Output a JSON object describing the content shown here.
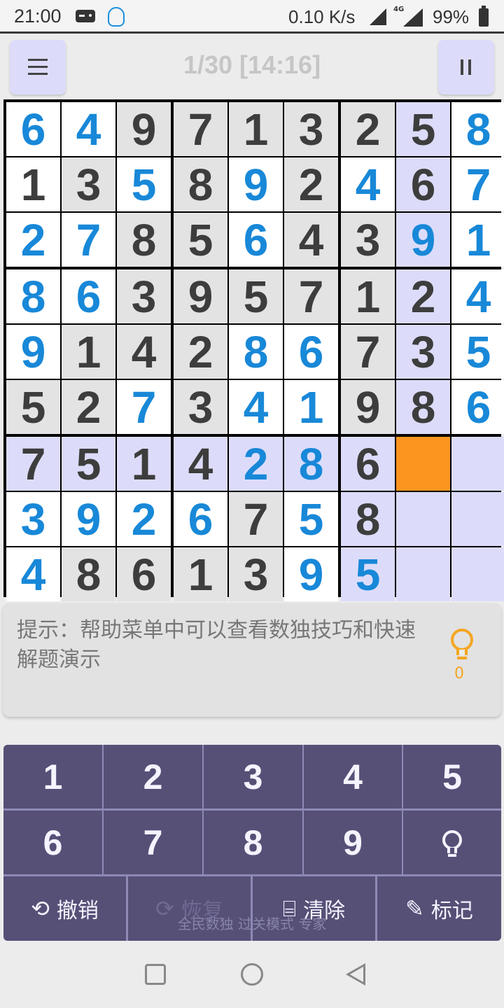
{
  "status_bar": {
    "time": "21:00",
    "network_speed": "0.10 K/s",
    "network_type": "4G",
    "battery": "99%"
  },
  "header": {
    "progress": "1/30 [14:16]"
  },
  "sudoku": {
    "rows": [
      [
        6,
        4,
        9,
        7,
        1,
        3,
        2,
        5,
        8
      ],
      [
        1,
        3,
        5,
        8,
        9,
        2,
        4,
        6,
        7
      ],
      [
        2,
        7,
        8,
        5,
        6,
        4,
        3,
        9,
        1
      ],
      [
        8,
        6,
        3,
        9,
        5,
        7,
        1,
        2,
        4
      ],
      [
        9,
        1,
        4,
        2,
        8,
        6,
        7,
        3,
        5
      ],
      [
        5,
        2,
        7,
        3,
        4,
        1,
        9,
        8,
        6
      ],
      [
        7,
        5,
        1,
        4,
        2,
        8,
        6,
        null,
        null
      ],
      [
        3,
        9,
        2,
        6,
        7,
        5,
        8,
        null,
        null
      ],
      [
        4,
        8,
        6,
        1,
        3,
        9,
        5,
        null,
        null
      ]
    ],
    "given_mask": [
      "UUGGGGGGU",
      "GGUGUGUGU",
      "UUGGUGGUU",
      "UUGGGGGGU",
      "UGGGUUGGU",
      "GGUGUUGGU",
      "GGGGUUGEE",
      "UUUUGUGEE",
      "UGGGGUUEE"
    ],
    "background_map": [
      "WWGGGGGHW",
      "WGWGWGWHW",
      "WWGGWGGHW",
      "WWGGGGGHW",
      "WGGGWWGHW",
      "GGWGWWGHW",
      "HHHHHHHSH",
      "WWWWGWHHH",
      "WGGGGWHHH"
    ],
    "selected_cell": {
      "row": 7,
      "col": 8
    },
    "colors": {
      "given_digit": "#3d3d3d",
      "user_digit": "#1888d8",
      "highlight": "#dcdcfa",
      "selected": "#fb951f",
      "prefilled_bg": "#e3e3e3"
    }
  },
  "hint_panel": {
    "text": "提示：帮助菜单中可以查看数独技巧和快速解题演示",
    "hint_count": "0",
    "icon": "lightbulb-icon"
  },
  "keypad": {
    "numbers": [
      "1",
      "2",
      "3",
      "4",
      "5",
      "6",
      "7",
      "8",
      "9"
    ],
    "hint_icon": "lightbulb-icon",
    "actions": {
      "undo": "撤销",
      "redo": "恢复",
      "clear": "清除",
      "mark": "标记"
    }
  },
  "footer": {
    "text": "全民数独 过关模式 专家"
  }
}
